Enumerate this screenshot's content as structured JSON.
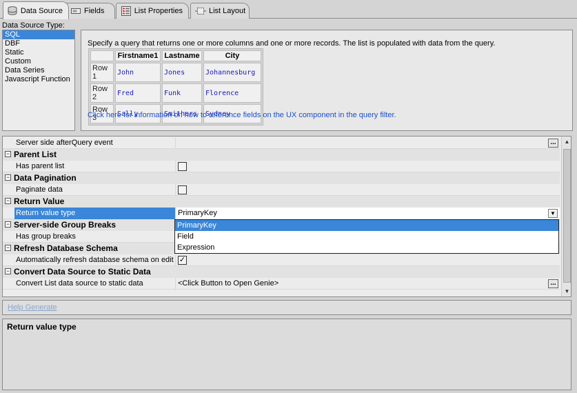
{
  "tabs": [
    {
      "label": "Data Source",
      "icon": "database-icon",
      "active": true
    },
    {
      "label": "Fields",
      "icon": "fields-icon",
      "active": false
    },
    {
      "label": "List Properties",
      "icon": "list-properties-icon",
      "active": false
    },
    {
      "label": "List Layout",
      "icon": "list-layout-icon",
      "active": false
    }
  ],
  "data_source": {
    "label": "Data Source Type:",
    "types": [
      "SQL",
      "DBF",
      "Static",
      "Custom",
      "Data Series",
      "Javascript Function"
    ],
    "selected": "SQL"
  },
  "info": {
    "description": "Specify a query that returns one or more columns and one or more records. The list is populated with data from the query.",
    "table": {
      "headers": [
        "",
        "Firstname1",
        "Lastname",
        "City"
      ],
      "rows": [
        [
          "Row 1",
          "John",
          "Jones",
          "Johannesburg"
        ],
        [
          "Row 2",
          "Fred",
          "Funk",
          "Florence"
        ],
        [
          "Row 3",
          "Sally",
          "Smithers",
          "Sydney"
        ]
      ]
    },
    "link": "Click here for information on how to reference fields on the UX component in the query filter."
  },
  "properties": {
    "server_side_after_query": "Server side afterQuery event",
    "parent_list_cat": "Parent List",
    "has_parent_list": "Has parent list",
    "data_pagination_cat": "Data Pagination",
    "paginate_data": "Paginate data",
    "return_value_cat": "Return Value",
    "return_value_type": "Return value type",
    "return_value_type_value": "PrimaryKey",
    "group_breaks_cat": "Server-side Group Breaks",
    "has_group_breaks": "Has group breaks",
    "refresh_schema_cat": "Refresh Database Schema",
    "auto_refresh_schema": "Automatically refresh database schema on edit",
    "auto_refresh_checked": "✓",
    "convert_cat": "Convert Data Source to Static Data",
    "convert_list": "Convert List data source to static data",
    "convert_list_value": "<Click Button to Open Genie>",
    "ellipsis": "..."
  },
  "dropdown": {
    "options": [
      "PrimaryKey",
      "Field",
      "Expression"
    ],
    "selected": "PrimaryKey"
  },
  "help_generate": "Help Generate",
  "description_title": "Return value type"
}
